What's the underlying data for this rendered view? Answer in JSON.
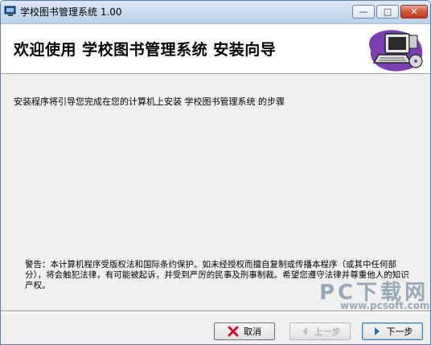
{
  "window": {
    "title": "学校图书管理系统 1.00",
    "controls": {
      "minimize": "—",
      "maximize": "□",
      "close": "✕"
    }
  },
  "header": {
    "title": "欢迎使用 学校图书管理系统 安装向导",
    "logo_icon": "computer-setup-icon"
  },
  "content": {
    "intro": "安装程序将引导您完成在您的计算机上安装 学校图书管理系统 的步骤",
    "warning": "警告：本计算机程序受版权法和国际条约保护。如未经授权而擅自复制或传播本程序（或其中任何部分），将会触犯法律，有可能被起诉，并受到严厉的民事及刑事制裁。希望您遵守法律并尊重他人的知识产权。"
  },
  "buttons": {
    "cancel": "取消",
    "back": "上一步",
    "next": "下一步"
  },
  "watermark": {
    "brand": "PC下载网",
    "url": "www.pcsoft.com.cn"
  },
  "colors": {
    "titlebar": "#c7daf0",
    "close_button": "#c43a22",
    "cancel_icon": "#c8102e",
    "next_icon": "#1f6fc0"
  }
}
